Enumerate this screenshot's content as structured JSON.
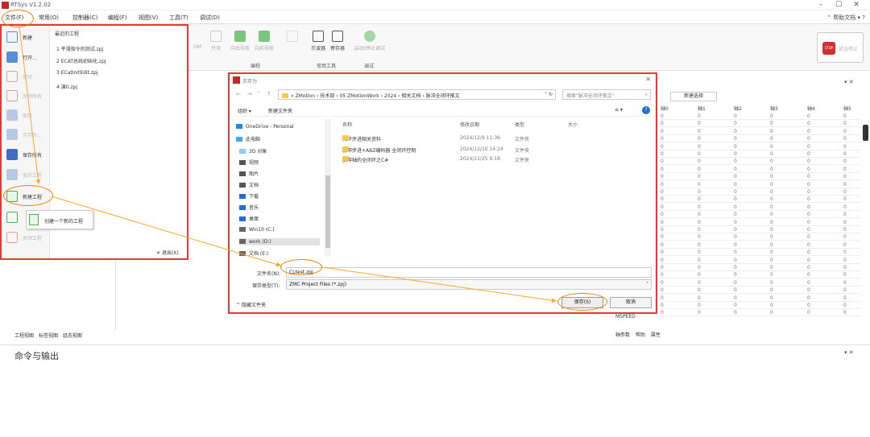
{
  "app": {
    "title": "RTSys V1.2.02",
    "help_doc": "帮助文档"
  },
  "menu": [
    "文件(F)",
    "常用(O)",
    "控制器(C)",
    "编程(F)",
    "视图(V)",
    "工具(T)",
    "调试(D)"
  ],
  "ribbon": {
    "buttons": [
      "只读",
      "向后导航",
      "向前导航",
      "示波器",
      "寄存器",
      "启动/停止调试"
    ],
    "groups": [
      "编程",
      "常用工具",
      "调试"
    ],
    "partial": "OM",
    "stop_label": "紧急停止",
    "stop_icon_text": "STOP"
  },
  "file_menu": {
    "items": [
      {
        "label": "新建",
        "icon": "new-file-icon",
        "enabled": true
      },
      {
        "label": "打开...",
        "icon": "open-folder-icon",
        "enabled": true
      },
      {
        "label": "关闭",
        "icon": "close-file-icon",
        "enabled": false
      },
      {
        "label": "关闭所有",
        "icon": "close-all-icon",
        "enabled": false
      },
      {
        "label": "保存",
        "icon": "save-icon",
        "enabled": false
      },
      {
        "label": "另存为...",
        "icon": "save-as-icon",
        "enabled": false
      },
      {
        "label": "保存所有",
        "icon": "save-all-icon",
        "enabled": true
      },
      {
        "label": "保存工程",
        "icon": "save-project-icon",
        "enabled": false
      },
      {
        "label": "新建工程",
        "icon": "new-project-icon",
        "enabled": true
      },
      {
        "label": "",
        "icon": "project-check-icon",
        "enabled": true
      },
      {
        "label": "关闭工程",
        "icon": "close-project-icon",
        "enabled": false
      }
    ],
    "recent_title": "最近的工程",
    "recent": [
      "1 平滑指令的测试.zpj",
      "2 ECAT总线初始化.zpj",
      "3 ECatInitEdit.zpj",
      "4 演0.zpj"
    ],
    "exit": "退出(X)",
    "tooltip": "创建一个新的工程"
  },
  "left_panel": {
    "tabs": [
      "工程视图",
      "标签视图",
      "组态视图"
    ]
  },
  "right_panel": {
    "tab_top": "新建选择",
    "columns": [
      "轴0",
      "轴1",
      "轴2",
      "轴3",
      "轴4",
      "轴5",
      "轴6"
    ],
    "cell": "0",
    "row_label": "MSPEED",
    "tabs": [
      "轴参数",
      "帮助",
      "属性"
    ]
  },
  "command_panel": {
    "title": "命令与输出"
  },
  "dialog": {
    "title": "另存为",
    "path": [
      "ZMotion",
      "技术部",
      "05 ZMotionWork",
      "2024",
      "相关文档",
      "脉冲全闭环推文"
    ],
    "search_placeholder": "搜索\"脉冲全闭环推文\"",
    "organize": "组织 ▾",
    "new_folder": "新建文件夹",
    "view_icon": "≡ ▾",
    "help": "?",
    "nav": [
      {
        "label": "OneDrive - Personal",
        "icon": "cloud-icon"
      },
      {
        "label": "此电脑",
        "icon": "computer-icon"
      },
      {
        "label": "3D 对象",
        "icon": "cube-icon"
      },
      {
        "label": "视频",
        "icon": "video-icon"
      },
      {
        "label": "图片",
        "icon": "picture-icon"
      },
      {
        "label": "文档",
        "icon": "document-icon"
      },
      {
        "label": "下载",
        "icon": "download-icon"
      },
      {
        "label": "音乐",
        "icon": "music-icon"
      },
      {
        "label": "桌面",
        "icon": "desktop-icon"
      },
      {
        "label": "Win10 (C:)",
        "icon": "drive-icon"
      },
      {
        "label": "work (D:)",
        "icon": "drive-icon"
      },
      {
        "label": "文档 (E:)",
        "icon": "drive-icon"
      }
    ],
    "headers": [
      "名称",
      "修改日期",
      "类型",
      "大小"
    ],
    "files": [
      {
        "name": "闭环步进相关资料",
        "date": "2024/12/9 11:36",
        "type": "文件夹"
      },
      {
        "name": "脉冲步进+ABZ编码器 全闭环控制",
        "date": "2024/12/10 14:24",
        "type": "文件夹"
      },
      {
        "name": "脉冲轴的全闭环之C#",
        "date": "2024/11/25 9:18",
        "type": "文件夹"
      }
    ],
    "filename_label": "文件名(N):",
    "filename_value": "CLtest.zpj",
    "filetype_label": "保存类型(T):",
    "filetype_value": "ZMC Project Files (*.zpj)",
    "hide_folders": "隐藏文件夹",
    "save": "保存(S)",
    "cancel": "取消"
  },
  "colors": {
    "accent_red": "#e53935",
    "annotation_orange": "#f57c00"
  }
}
